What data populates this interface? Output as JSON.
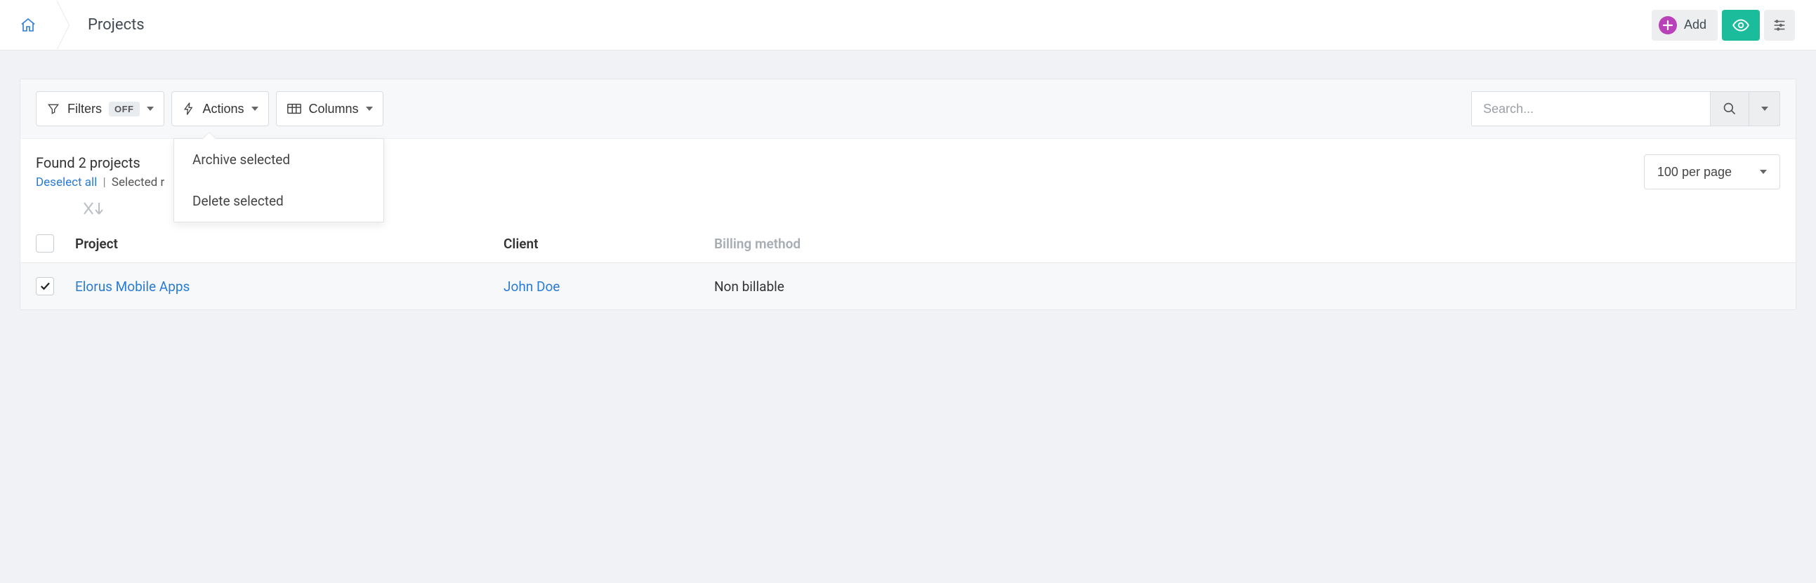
{
  "header": {
    "title": "Projects",
    "add_label": "Add"
  },
  "toolbar": {
    "filters_label": "Filters",
    "filters_state": "OFF",
    "actions_label": "Actions",
    "columns_label": "Columns",
    "search_placeholder": "Search..."
  },
  "actions_menu": {
    "items": [
      {
        "label": "Archive selected"
      },
      {
        "label": "Delete selected"
      }
    ]
  },
  "meta": {
    "found_text": "Found 2 projects",
    "deselect_label": "Deselect all",
    "separator": "|",
    "selected_text": "Selected r",
    "per_page_label": "100 per page"
  },
  "table": {
    "columns": {
      "project": "Project",
      "client": "Client",
      "billing": "Billing method"
    },
    "rows": [
      {
        "project": "Elorus Mobile Apps",
        "client": "John Doe",
        "billing": "Non billable",
        "checked": true
      }
    ]
  }
}
